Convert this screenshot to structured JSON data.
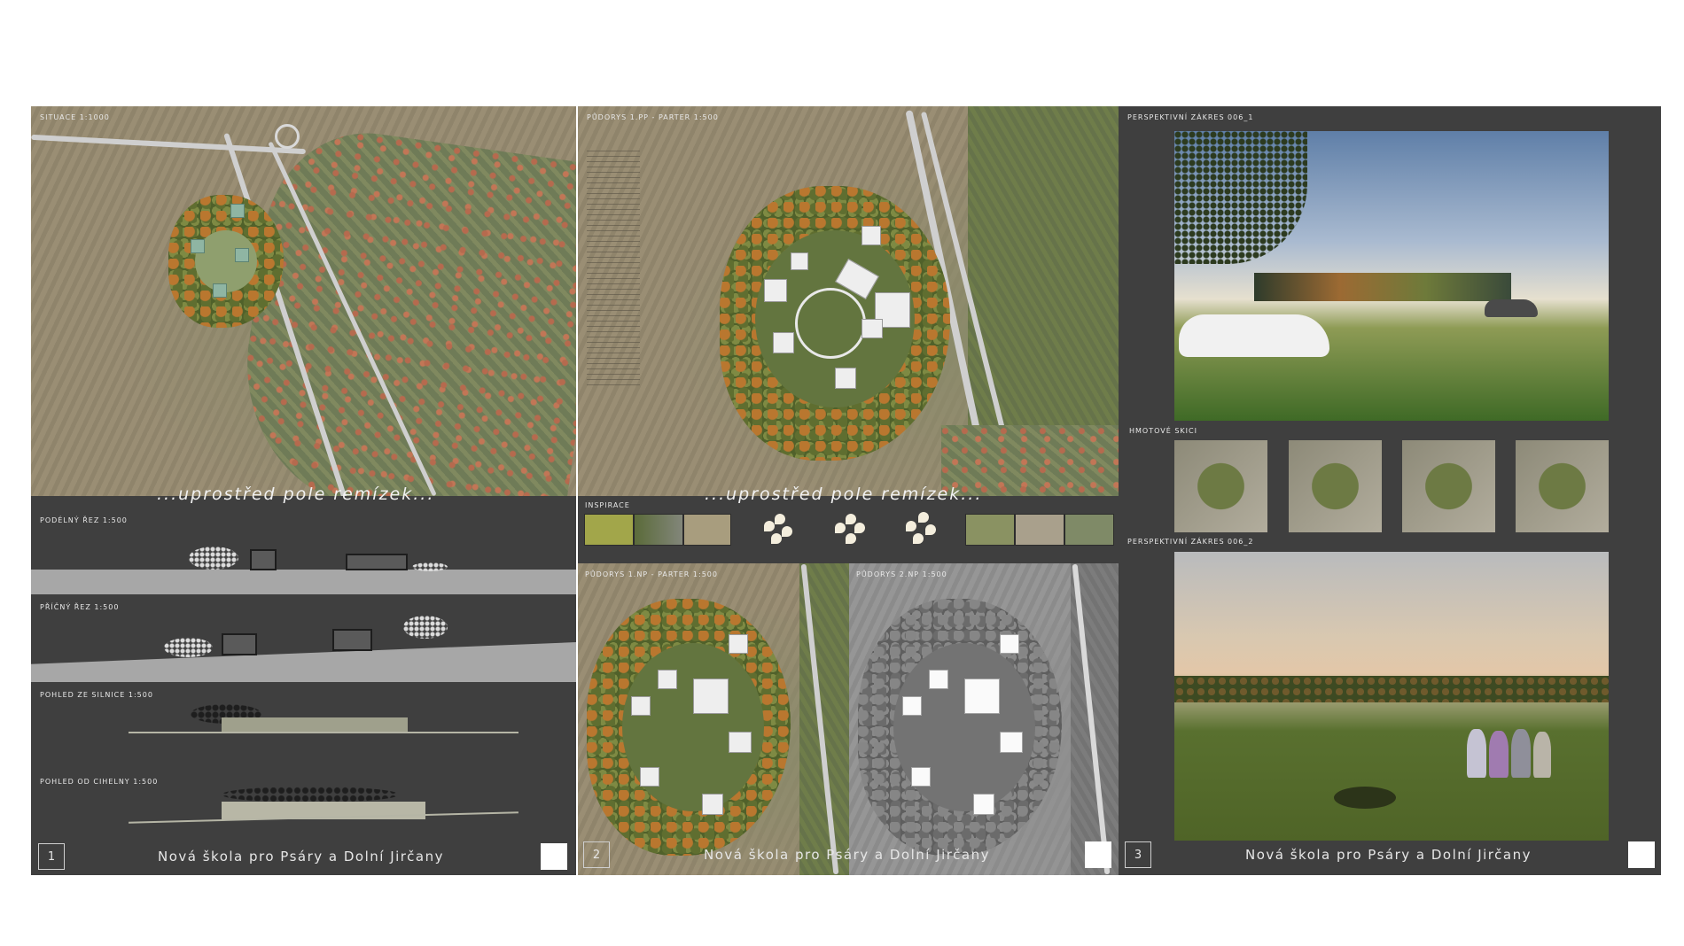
{
  "sheet1": {
    "labels": {
      "situace": "SITUACE 1:1000",
      "podelny": "PODÉLNÝ ŘEZ 1:500",
      "pricny": "PŘÍČNÝ ŘEZ 1:500",
      "pohled_silnice": "POHLED ZE SILNICE 1:500",
      "pohled_cihelny": "POHLED OD CIHELNY 1:500"
    },
    "tagline": "...uprostřed pole remízek...",
    "page_number": "1",
    "footer_title": "Nová škola pro Psáry a Dolní Jirčany"
  },
  "sheet2": {
    "labels": {
      "podorys_pp": "PŮDORYS 1.PP - PARTER 1:500",
      "inspirace": "INSPIRACE",
      "podorys_1np": "PŮDORYS 1.NP - PARTER 1:500",
      "podorys_2np": "PŮDORYS 2.NP 1:500"
    },
    "tagline": "...uprostřed pole remízek...",
    "page_number": "2",
    "footer_title": "Nová škola pro Psáry a Dolní Jirčany"
  },
  "sheet3": {
    "labels": {
      "perspektiva1": "PERSPEKTIVNÍ ZÁKRES 006_1",
      "hmotove": "HMOTOVÉ SKICI",
      "perspektiva2": "PERSPEKTIVNÍ ZÁKRES 006_2"
    },
    "page_number": "3",
    "footer_title": "Nová škola pro Psáry a Dolní Jirčany"
  },
  "colors": {
    "panel": "#3f3f3f",
    "text": "#e8e8e8",
    "page_bg": "#ffffff"
  }
}
